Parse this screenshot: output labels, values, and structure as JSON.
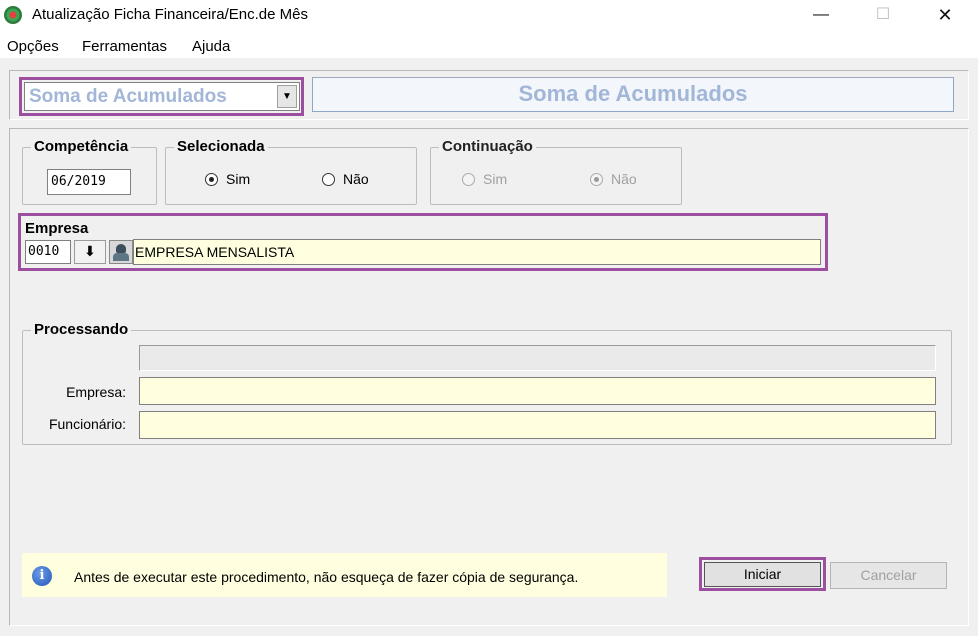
{
  "window": {
    "title": "Atualização Ficha Financeira/Enc.de Mês",
    "minimize_glyph": "—",
    "maximize_glyph": "☐",
    "close_glyph": "✕"
  },
  "menu": [
    "Opções",
    "Ferramentas",
    "Ajuda"
  ],
  "procedure": {
    "selected": "Soma de Acumulados",
    "banner": "Soma de Acumulados",
    "dropdown_glyph": "▼"
  },
  "competencia": {
    "label": "Competência",
    "value": "06/2019"
  },
  "selecionada": {
    "label": "Selecionada",
    "options": [
      "Sim",
      "Não"
    ],
    "selected": "Sim"
  },
  "continuacao": {
    "label": "Continuação",
    "options": [
      "Sim",
      "Não"
    ],
    "selected": "Não",
    "enabled": false
  },
  "empresa": {
    "label": "Empresa",
    "code": "0010",
    "download_glyph": "⬇",
    "name": "EMPRESA MENSALISTA"
  },
  "processando": {
    "label": "Processando",
    "progress": 0,
    "empresa_label": "Empresa:",
    "empresa_value": "",
    "funcionario_label": "Funcionário:",
    "funcionario_value": ""
  },
  "info": {
    "icon": "info-icon",
    "glyph": "i",
    "text": "Antes de executar este procedimento, não esqueça de fazer cópia de segurança."
  },
  "buttons": {
    "start": "Iniciar",
    "cancel": "Cancelar"
  },
  "colors": {
    "highlight": "#9b4f9e",
    "banner_text": "#a2b6d8",
    "field_yellow": "#ffffe0"
  }
}
